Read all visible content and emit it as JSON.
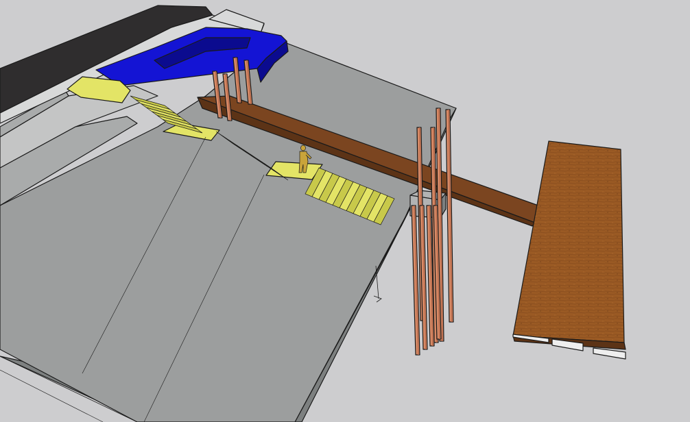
{
  "viewport": {
    "background_color": "#cdcdcf"
  },
  "model": {
    "colors": {
      "ground_top": "#9c9e9e",
      "ground_side": "#7d8080",
      "terrace_light": "#c4c5c5",
      "terrace_mid": "#a9abab",
      "road": "#2f2d2e",
      "curb": "#d8d9d9",
      "stairs_fill": "#e3e466",
      "stairs_dark": "#c8c94a",
      "blue_ramp": "#1414d4",
      "blue_ramp_dark": "#0b0b8f",
      "walkway_top": "#7b4520",
      "walkway_side": "#5c3316",
      "deck_top": "#9a5a24",
      "deck_texture": "#7f451a",
      "post_fill": "#d88b67",
      "post_shade": "#b96b4c",
      "pile_cap": "#b2b3b3",
      "pontoon": "#eeeeee",
      "figure": "#c9a43a"
    },
    "objects": [
      "ground-terrace",
      "road",
      "yellow-stairs",
      "blue-ramp",
      "timber-walkway",
      "timber-posts",
      "floating-deck",
      "pontoons",
      "scale-figure"
    ]
  }
}
